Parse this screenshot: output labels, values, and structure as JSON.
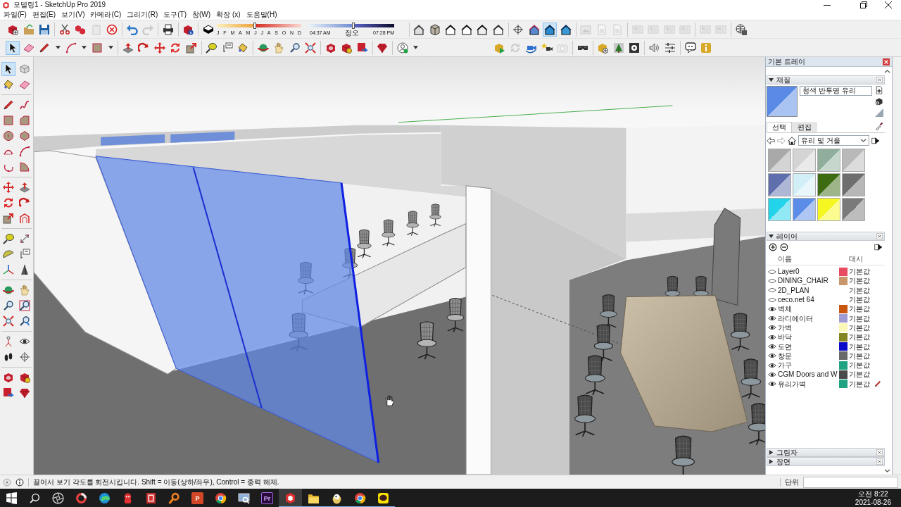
{
  "window": {
    "title": "모델링1 - SketchUp Pro 2019"
  },
  "menu": [
    "파일(F)",
    "편집(E)",
    "보기(V)",
    "카메라(C)",
    "그리기(R)",
    "도구(T)",
    "창(W)",
    "확장 (x)",
    "도움말(H)"
  ],
  "toolbar_top": [
    {
      "selected": false,
      "disabled": false
    },
    {
      "selected": false,
      "disabled": false
    },
    {
      "selected": false,
      "disabled": false
    },
    {
      "selected": false,
      "disabled": false
    },
    {
      "selected": false,
      "disabled": false
    },
    {
      "selected": false,
      "disabled": true
    },
    {
      "selected": false,
      "disabled": false
    },
    {
      "selected": false,
      "disabled": false
    },
    {
      "selected": false,
      "disabled": true
    },
    {
      "selected": false,
      "disabled": false
    },
    {
      "selected": false,
      "disabled": false
    },
    {
      "selected": false,
      "disabled": false
    },
    {
      "selected": false,
      "disabled": false
    },
    {
      "selected": false,
      "disabled": false
    },
    {
      "selected": false,
      "disabled": false
    },
    {
      "selected": false,
      "disabled": false
    },
    {
      "selected": false,
      "disabled": false
    },
    {
      "selected": false,
      "disabled": false
    },
    {
      "selected": false,
      "disabled": false
    },
    {
      "selected": false,
      "disabled": false
    },
    {
      "selected": true,
      "disabled": false
    },
    {
      "selected": false,
      "disabled": false
    },
    {
      "selected": false,
      "disabled": true
    },
    {
      "selected": false,
      "disabled": true
    },
    {
      "selected": false,
      "disabled": true
    },
    {
      "selected": false,
      "disabled": true
    },
    {
      "selected": false,
      "disabled": true
    },
    {
      "selected": false,
      "disabled": true
    },
    {
      "selected": false,
      "disabled": true
    },
    {
      "selected": false,
      "disabled": true
    },
    {
      "selected": false,
      "disabled": true
    },
    {
      "selected": false,
      "disabled": false
    }
  ],
  "shadow_sliders": {
    "months": {
      "labels": [
        "J",
        "F",
        "M",
        "A",
        "M",
        "J",
        "J",
        "A",
        "S",
        "O",
        "N",
        "D"
      ],
      "level": 0.45
    },
    "time": {
      "labels": [
        "04:37 AM",
        "정오",
        "07:28 PM"
      ],
      "level": 0.52
    }
  },
  "toolbar_second": [
    {
      "selected": true
    },
    {
      "selected": false
    },
    {
      "selected": false
    },
    {
      "selected": false
    },
    {
      "selected": false
    },
    {
      "selected": false
    },
    {
      "selected": false
    },
    {
      "selected": false
    },
    {
      "selected": false
    },
    {
      "selected": false
    },
    {
      "selected": false
    },
    {
      "selected": false
    },
    {
      "selected": false
    },
    {
      "selected": false
    },
    {
      "selected": false
    },
    {
      "selected": false
    },
    {
      "selected": false
    },
    {
      "selected": false
    },
    {
      "selected": false
    },
    {
      "selected": false
    },
    {
      "selected": false
    },
    {
      "selected": false
    }
  ],
  "toolbar_extensions": [
    {
      "disabled": false
    },
    {
      "disabled": true
    },
    {
      "disabled": false
    },
    {
      "disabled": false
    },
    {
      "disabled": true
    },
    {
      "disabled": false
    },
    {
      "disabled": false
    },
    {
      "disabled": false
    },
    {
      "disabled": false
    },
    {
      "disabled": false
    },
    {
      "disabled": false
    },
    {
      "disabled": false
    },
    {
      "disabled": false
    }
  ],
  "tools_left": [
    {
      "selected": true
    },
    {
      "selected": false
    },
    {
      "selected": false
    },
    {
      "selected": false
    },
    {
      "selected": false
    },
    {
      "selected": false
    },
    {
      "selected": false
    },
    {
      "selected": false
    },
    {
      "selected": false
    },
    {
      "selected": false
    },
    {
      "selected": false
    },
    {
      "selected": false
    },
    {
      "selected": false
    },
    {
      "selected": false
    },
    {
      "selected": false
    },
    {
      "selected": false
    },
    {
      "selected": false
    },
    {
      "selected": false
    },
    {
      "selected": false
    },
    {
      "selected": false
    },
    {
      "selected": false
    },
    {
      "selected": false
    },
    {
      "selected": false
    },
    {
      "selected": false
    },
    {
      "selected": false
    },
    {
      "selected": false
    },
    {
      "selected": false
    },
    {
      "selected": false
    },
    {
      "selected": false
    },
    {
      "selected": false
    },
    {
      "selected": false
    },
    {
      "selected": false
    },
    {
      "selected": false
    },
    {
      "selected": false
    },
    {
      "selected": false
    },
    {
      "selected": false
    },
    {
      "selected": false
    },
    {
      "selected": false
    },
    {
      "selected": false
    },
    {
      "selected": false
    }
  ],
  "tray": {
    "title": "기본 트레이",
    "sections": [
      {
        "kind": "materials",
        "title": "재질",
        "expanded": true,
        "material_name": "청색 반투명 유리",
        "tabs": [
          {
            "label": "선택",
            "selected": true
          },
          {
            "label": "편집",
            "selected": false
          }
        ],
        "library": "유리 및 거울",
        "swatches": [
          {
            "color": "#a9a9a9"
          },
          {
            "color": "#d4d4d4"
          },
          {
            "color": "#8fae9c"
          },
          {
            "color": "#b9b9b9"
          },
          {
            "color": "#5f6fae"
          },
          {
            "color": "#d2eef6"
          },
          {
            "color": "#3c6b12"
          },
          {
            "color": "#6e6e6e"
          },
          {
            "color": "#22d3ea"
          },
          {
            "color": "#5b8de8"
          },
          {
            "color": "#f6f620"
          },
          {
            "color": "#7a7a7a"
          }
        ]
      },
      {
        "kind": "layers",
        "title": "레이어",
        "expanded": true,
        "columns": [
          "이름",
          "대시"
        ],
        "rows": [
          {
            "visible": false,
            "name": "Layer0",
            "color": "#e84a5f",
            "dash": "기본값",
            "current": false
          },
          {
            "visible": false,
            "name": "DINING_CHAIR",
            "color": "#c9976b",
            "dash": "기본값",
            "current": false
          },
          {
            "visible": false,
            "name": "2D_PLAN",
            "dash": "기본값",
            "current": false
          },
          {
            "visible": false,
            "name": "ceco.net 64",
            "dash": "기본값",
            "current": false
          },
          {
            "visible": true,
            "name": "벽체",
            "color": "#c8560e",
            "dash": "기본값",
            "current": false
          },
          {
            "visible": true,
            "name": "라디에이터",
            "color": "#a09cd4",
            "dash": "기본값",
            "current": false
          },
          {
            "visible": true,
            "name": "가벽",
            "color": "#fbf7b8",
            "dash": "기본값",
            "current": false
          },
          {
            "visible": true,
            "name": "바닥",
            "color": "#848522",
            "dash": "기본값",
            "current": false
          },
          {
            "visible": true,
            "name": "도면",
            "color": "#0a0ac8",
            "dash": "기본값",
            "current": false
          },
          {
            "visible": true,
            "name": "창문",
            "color": "#696969",
            "dash": "기본값",
            "current": false
          },
          {
            "visible": true,
            "name": "가구",
            "color": "#1fa383",
            "dash": "기본값",
            "current": false
          },
          {
            "visible": true,
            "name": "CGM Doors and W",
            "color": "#4a4a4a",
            "dash": "기본값",
            "current": false
          },
          {
            "visible": true,
            "name": "유리가벽",
            "color": "#1fa383",
            "dash": "기본값",
            "current": true
          }
        ]
      },
      {
        "kind": "shadows",
        "title": "그림자",
        "expanded": false
      },
      {
        "kind": "scenes",
        "title": "장면",
        "expanded": false
      }
    ]
  },
  "status_bar": {
    "message": "끌어서 보기 각도를 회전시킵니다. Shift = 이동(상하/좌우), Control = 중력 해제.",
    "measurement_label": "단위"
  },
  "taskbar": {
    "apps": [
      {
        "active": false,
        "running": false
      },
      {
        "active": false,
        "running": false
      },
      {
        "active": false,
        "running": false
      },
      {
        "active": false,
        "running": false
      },
      {
        "active": false,
        "running": false
      },
      {
        "active": false,
        "running": false
      },
      {
        "active": false,
        "running": false
      },
      {
        "active": false,
        "running": false
      },
      {
        "label": "P",
        "active": false,
        "running": false
      },
      {
        "active": false,
        "running": false
      },
      {
        "active": false,
        "running": false
      },
      {
        "label": "Pr",
        "active": false,
        "running": false
      },
      {
        "active": true,
        "running": true
      },
      {
        "active": false,
        "running": true
      },
      {
        "active": false,
        "running": true
      },
      {
        "active": false,
        "running": true
      },
      {
        "active": false,
        "running": true
      }
    ],
    "time": "오전 8:22",
    "date": "2021-08-26"
  }
}
